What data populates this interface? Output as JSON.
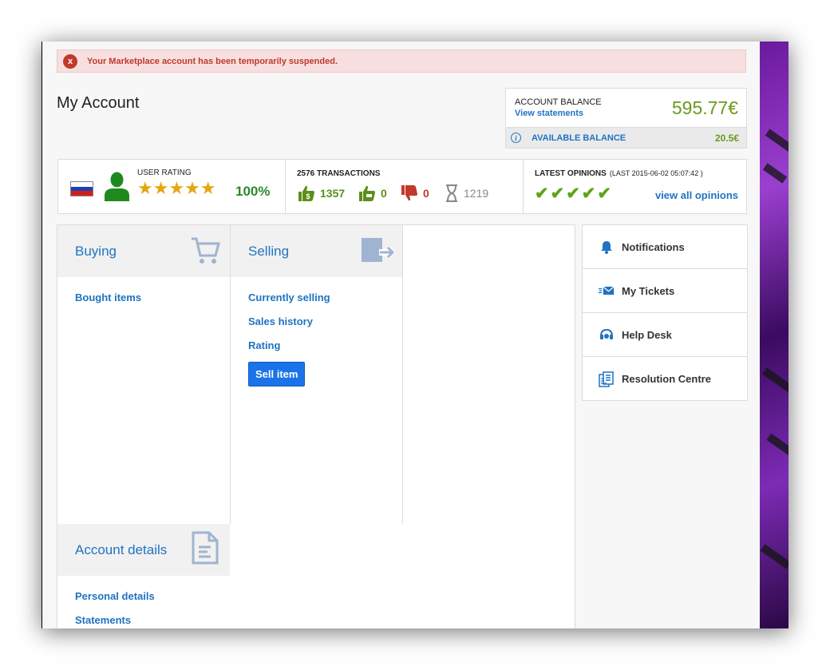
{
  "alert": {
    "icon": "x",
    "message": "Your Marketplace account has been temporarily suspended."
  },
  "page_title": "My Account",
  "balance": {
    "label": "ACCOUNT BALANCE",
    "statements_link": "View statements",
    "amount": "595.77€",
    "available_label": "AVAILABLE BALANCE",
    "available_amount": "20.5€",
    "info_icon": "i"
  },
  "user_rating": {
    "label": "USER RATING",
    "stars": "★★★★★",
    "percent": "100%",
    "country": "Russia"
  },
  "transactions": {
    "label": "2576 TRANSACTIONS",
    "positive": "1357",
    "neutral": "0",
    "negative": "0",
    "pending": "1219"
  },
  "opinions": {
    "label": "LATEST OPINIONS",
    "date": "(LAST 2015-06-02 05:07:42 )",
    "checks": "✔✔✔✔✔",
    "view_all": "view all opinions"
  },
  "buying": {
    "title": "Buying",
    "links": [
      "Bought items"
    ]
  },
  "selling": {
    "title": "Selling",
    "links": [
      "Currently selling",
      "Sales history",
      "Rating"
    ],
    "sell_button": "Sell item"
  },
  "account_details": {
    "title": "Account details",
    "links": [
      "Personal details",
      "Statements"
    ]
  },
  "side_menu": [
    {
      "label": "Notifications",
      "icon": "bell-icon"
    },
    {
      "label": "My Tickets",
      "icon": "envelope-icon"
    },
    {
      "label": "Help Desk",
      "icon": "headset-icon"
    },
    {
      "label": "Resolution Centre",
      "icon": "documents-icon"
    }
  ],
  "colors": {
    "link": "#1f73c2",
    "money": "#6b9a1a",
    "alert": "#c0392b",
    "star": "#e5a711"
  }
}
